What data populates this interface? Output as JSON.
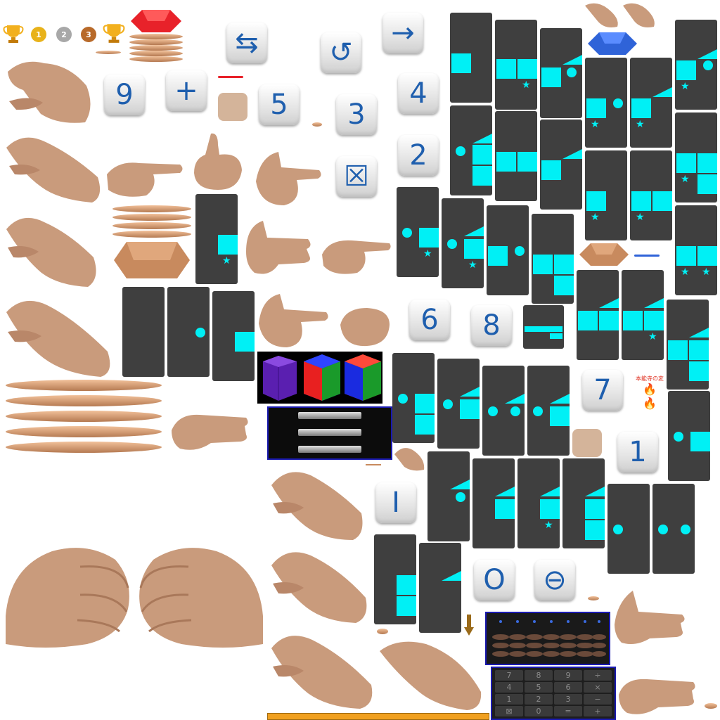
{
  "medals": {
    "gold_num": "1",
    "silver_num": "2",
    "bronze_num": "3"
  },
  "number_tiles": [
    "9",
    "5",
    "3",
    "4",
    "2",
    "6",
    "8",
    "7",
    "1",
    "I",
    "O"
  ],
  "symbol_tiles": {
    "plus": "+",
    "swap": "⇆",
    "undo": "↺",
    "arrow_right": "→",
    "close_box": "☒",
    "minus_circle": "⊖"
  },
  "keypad": {
    "keys": [
      "7",
      "8",
      "9",
      "÷",
      "4",
      "5",
      "6",
      "×",
      "1",
      "2",
      "3",
      "−",
      "⊠",
      "0",
      "=",
      "+"
    ]
  },
  "promo": {
    "line1": "本能寺の変",
    "emoji": "🔥"
  },
  "colors": {
    "accent": "#00f0f5",
    "card_bg": "#3f3f3f",
    "tile_text": "#1f5fae",
    "gem_red": "#e8222a",
    "gem_blue": "#2f63d8",
    "wood": "#c88a5e",
    "frame_blue": "#1a1ab0",
    "bar_orange": "#f0a020"
  }
}
